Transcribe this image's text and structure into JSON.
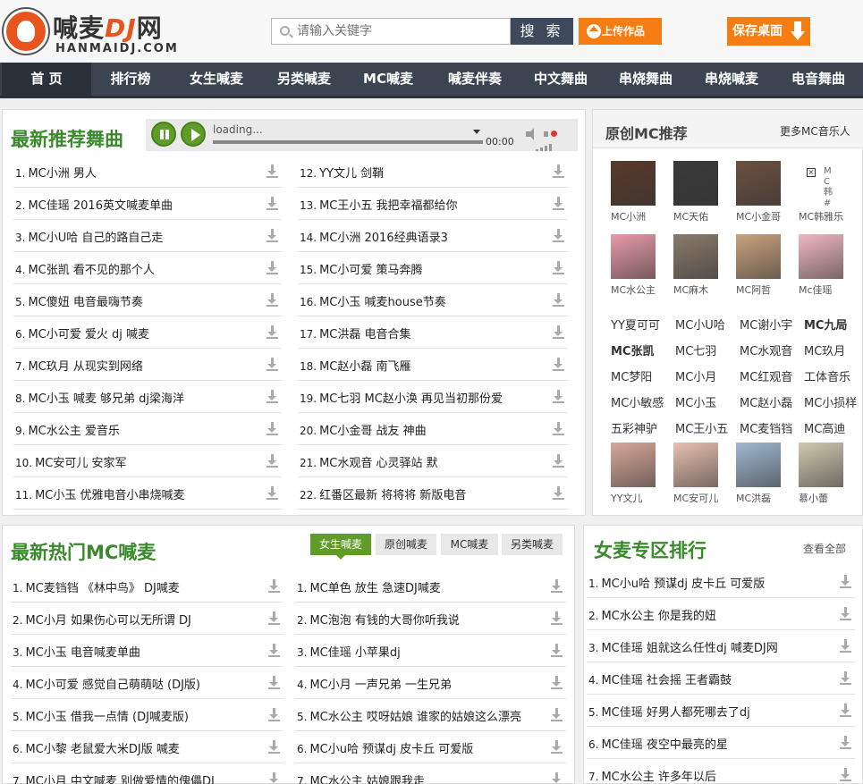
{
  "header": {
    "logo_main": "喊麦",
    "logo_dj": "DJ",
    "logo_suffix": "网",
    "logo_sub": "HANMAIDJ.COM",
    "search_placeholder": "请输入关键字",
    "search_button": "搜 索",
    "upload_button": "上传作品",
    "save_button": "保存桌面"
  },
  "nav": [
    "首 页",
    "排行榜",
    "女生喊麦",
    "另类喊麦",
    "MC喊麦",
    "喊麦伴奏",
    "中文舞曲",
    "串烧舞曲",
    "串烧喊麦",
    "电音舞曲"
  ],
  "recommended": {
    "title": "最新推荐舞曲",
    "player": {
      "status": "loading...",
      "time": "00:00"
    },
    "left": [
      {
        "num": "1.",
        "text": "MC小洲 男人"
      },
      {
        "num": "2.",
        "text": "MC佳瑶 2016英文喊麦单曲"
      },
      {
        "num": "3.",
        "text": "MC小U哈 自己的路自己走"
      },
      {
        "num": "4.",
        "text": "MC张凯 看不见的那个人"
      },
      {
        "num": "5.",
        "text": "MC傻妞 电音最嗨节奏"
      },
      {
        "num": "6.",
        "text": "MC小可爱 爱火 dj 喊麦"
      },
      {
        "num": "7.",
        "text": "MC玖月 从现实到网络"
      },
      {
        "num": "8.",
        "text": "MC小玉 喊麦 够兄弟 dj梁海洋"
      },
      {
        "num": "9.",
        "text": "MC水公主 爱音乐"
      },
      {
        "num": "10.",
        "text": "MC安可儿 安家军"
      },
      {
        "num": "11.",
        "text": "MC小玉 优雅电音小串烧喊麦"
      }
    ],
    "right": [
      {
        "num": "12.",
        "text": "YY文儿 剑鞘"
      },
      {
        "num": "13.",
        "text": "MC王小五 我把幸福都给你"
      },
      {
        "num": "14.",
        "text": "MC小洲 2016经典语录3"
      },
      {
        "num": "15.",
        "text": "MC小可爱 策马奔腾"
      },
      {
        "num": "16.",
        "text": "MC小玉 喊麦house节奏"
      },
      {
        "num": "17.",
        "text": "MC洪磊 电音合集"
      },
      {
        "num": "18.",
        "text": "MC赵小磊 南飞雁"
      },
      {
        "num": "19.",
        "text": "MC七羽 MC赵小涣 再见当初那份爱"
      },
      {
        "num": "20.",
        "text": "MC小金哥 战友 神曲"
      },
      {
        "num": "21.",
        "text": "MC水观音 心灵驿站 默"
      },
      {
        "num": "22.",
        "text": "红番区最新 将将将 新版电音"
      }
    ]
  },
  "original_mc": {
    "title": "原创MC推荐",
    "more": "更多MC音乐人",
    "avatars_top": [
      {
        "name": "MC小洲",
        "color": "#5a3a2a"
      },
      {
        "name": "MC天佑",
        "color": "#3a3a3a"
      },
      {
        "name": "MC小金哥",
        "color": "#6b5040"
      },
      {
        "name": "MC韩雅乐",
        "color": "#ffffff"
      },
      {
        "name": "MC水公主",
        "color": "#e79aa8"
      },
      {
        "name": "MC麻木",
        "color": "#8a7a6a"
      },
      {
        "name": "MC阿哲",
        "color": "#c9a27e"
      },
      {
        "name": "Mc佳瑶",
        "color": "#f0b8c0"
      }
    ],
    "broken_alt": "MC韩#",
    "names": [
      [
        {
          "t": "YY夏可可",
          "b": false
        },
        {
          "t": "MC小U哈",
          "b": false
        },
        {
          "t": "MC谢小宇",
          "b": false
        },
        {
          "t": "MC九局",
          "b": true
        }
      ],
      [
        {
          "t": "MC张凯",
          "b": true
        },
        {
          "t": "MC七羽",
          "b": false
        },
        {
          "t": "MC水观音",
          "b": false
        },
        {
          "t": "MC玖月",
          "b": false
        }
      ],
      [
        {
          "t": "MC梦阳",
          "b": false
        },
        {
          "t": "MC小月",
          "b": false
        },
        {
          "t": "MC红观音",
          "b": false
        },
        {
          "t": "工体音乐",
          "b": false
        }
      ],
      [
        {
          "t": "MC小敏感",
          "b": false
        },
        {
          "t": "MC小玉",
          "b": false
        },
        {
          "t": "MC赵小磊",
          "b": false
        },
        {
          "t": "MC小损样",
          "b": false
        }
      ],
      [
        {
          "t": "五彩神驴",
          "b": false
        },
        {
          "t": "MC王小五",
          "b": false
        },
        {
          "t": "MC麦铛铛",
          "b": false
        },
        {
          "t": "MC高迪",
          "b": false
        }
      ]
    ],
    "avatars_bottom": [
      {
        "name": "YY文儿",
        "color": "#d8a89a"
      },
      {
        "name": "MC安可儿",
        "color": "#e8c0b0"
      },
      {
        "name": "MC洪磊",
        "color": "#a0b8d0"
      },
      {
        "name": "慕小蕾",
        "color": "#d0c8b0"
      }
    ]
  },
  "hot_mc": {
    "title": "最新热门MC喊麦",
    "tabs": [
      "女生喊麦",
      "原创喊麦",
      "MC喊麦",
      "另类喊麦"
    ],
    "left": [
      {
        "num": "1.",
        "text": "MC麦铛铛 《林中鸟》 DJ喊麦"
      },
      {
        "num": "2.",
        "text": "MC小月 如果伤心可以无所谓 DJ"
      },
      {
        "num": "3.",
        "text": "MC小玉 电音喊麦单曲"
      },
      {
        "num": "4.",
        "text": "MC小可爱 感觉自己萌萌哒 (DJ版)"
      },
      {
        "num": "5.",
        "text": "MC小玉 借我一点情 (DJ喊麦版)"
      },
      {
        "num": "6.",
        "text": "MC小黎 老鼠爱大米DJ版 喊麦"
      },
      {
        "num": "7.",
        "text": "MC小月 中文喊麦 别做爱情的傀儡DJ"
      }
    ],
    "right": [
      {
        "num": "1.",
        "text": "MC单色 放生 急速DJ喊麦"
      },
      {
        "num": "2.",
        "text": "MC泡泡 有钱的大哥你听我说"
      },
      {
        "num": "3.",
        "text": "MC佳瑶 小苹果dj"
      },
      {
        "num": "4.",
        "text": "MC小月 一声兄弟 一生兄弟"
      },
      {
        "num": "5.",
        "text": "MC水公主 哎呀姑娘 谁家的姑娘这么漂亮"
      },
      {
        "num": "6.",
        "text": "MC小u哈 预谋dj 皮卡丘 可爱版"
      },
      {
        "num": "7.",
        "text": "MC水公主 姑娘跟我走"
      }
    ]
  },
  "female_rank": {
    "title": "女麦专区排行",
    "more": "查看全部",
    "items": [
      {
        "num": "1.",
        "text": "MC小u哈 预谋dj 皮卡丘 可爱版"
      },
      {
        "num": "2.",
        "text": "MC水公主 你是我的妞"
      },
      {
        "num": "3.",
        "text": "MC佳瑶 姐就这么任性dj 喊麦DJ网"
      },
      {
        "num": "4.",
        "text": "MC佳瑶 社会摇 王者霸鼓"
      },
      {
        "num": "5.",
        "text": "MC佳瑶 好男人都死哪去了dj"
      },
      {
        "num": "6.",
        "text": "MC佳瑶 夜空中最亮的星"
      },
      {
        "num": "7.",
        "text": "MC水公主 许多年以后"
      }
    ]
  }
}
